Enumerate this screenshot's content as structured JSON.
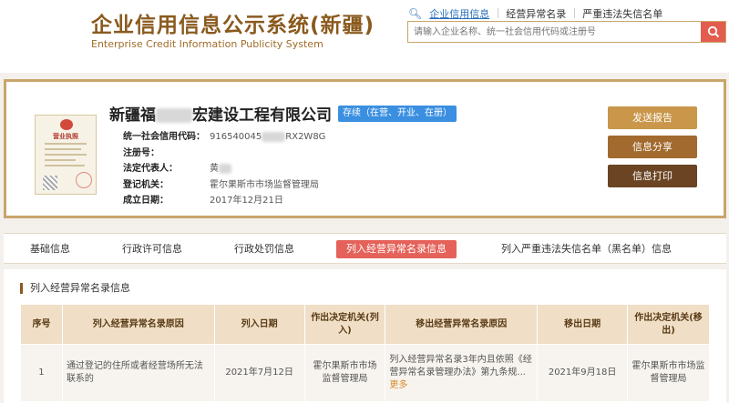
{
  "header": {
    "title": "企业信用信息公示系统(新疆)",
    "subtitle": "Enterprise Credit Information Publicity System",
    "search_tabs": [
      "企业信用信息",
      "经营异常名录",
      "严重违法失信名单"
    ],
    "search_placeholder": "请输入企业名称、统一社会信用代码或注册号"
  },
  "company": {
    "name_prefix": "新疆福",
    "name_suffix": "宏建设工程有限公司",
    "status": "存续（在营、开业、在册）",
    "license_title": "营业执照",
    "fields": [
      {
        "label": "统一社会信用代码：",
        "value_prefix": "916540045",
        "value_suffix": "RX2W8G"
      },
      {
        "label": "注册号：",
        "value": ""
      },
      {
        "label": "法定代表人：",
        "value_prefix": "黄"
      },
      {
        "label": "登记机关：",
        "value": "霍尔果斯市市场监督管理局"
      },
      {
        "label": "成立日期：",
        "value": "2017年12月21日"
      }
    ],
    "buttons": {
      "report": "发送报告",
      "share": "信息分享",
      "print": "信息打印"
    }
  },
  "tabs": [
    "基础信息",
    "行政许可信息",
    "行政处罚信息",
    "列入经营异常名录信息",
    "列入严重违法失信名单（黑名单）信息"
  ],
  "section": {
    "title": "列入经营异常名录信息",
    "columns": [
      "序号",
      "列入经营异常名录原因",
      "列入日期",
      "作出决定机关(列入)",
      "移出经营异常名录原因",
      "移出日期",
      "作出决定机关(移出)"
    ],
    "row": {
      "index": "1",
      "reason": "通过登记的住所或者经营场所无法联系的",
      "date_in": "2021年7月12日",
      "authority_in": "霍尔果斯市市场监督管理局",
      "remove_reason": "列入经营异常名录3年内且依照《经营异常名录管理办法》第九条规...",
      "more": "更多",
      "date_out": "2021年9月18日",
      "authority_out": "霍尔果斯市市场监督管理局"
    }
  },
  "colors": {
    "brand": "#8a5a1e",
    "accent_red": "#e4625a",
    "status_blue": "#3a8fe0"
  }
}
